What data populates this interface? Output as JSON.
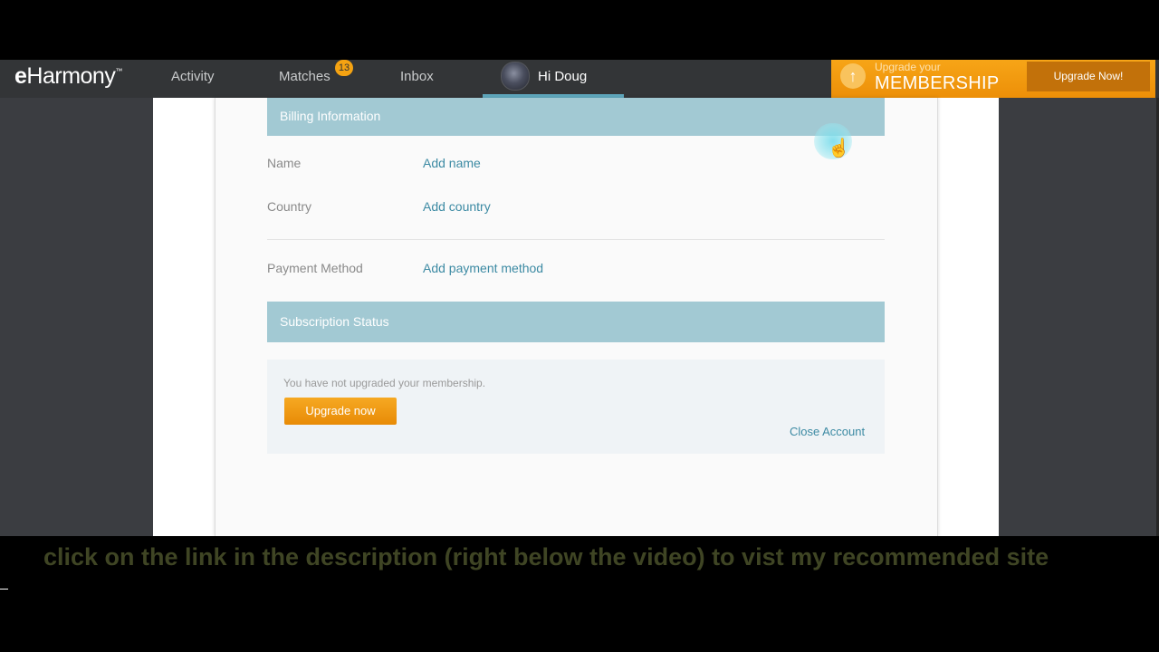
{
  "nav": {
    "logo": {
      "e": "e",
      "rest": "Harmony",
      "mark": "™"
    },
    "activity": "Activity",
    "matches": "Matches",
    "matches_badge": "13",
    "inbox": "Inbox",
    "user_greeting": "Hi Doug"
  },
  "upgrade_banner": {
    "small": "Upgrade your",
    "big": "MEMBERSHIP",
    "button": "Upgrade Now!",
    "icon": "↑"
  },
  "billing": {
    "header": "Billing Information",
    "name_label": "Name",
    "name_link": "Add name",
    "country_label": "Country",
    "country_link": "Add country",
    "payment_label": "Payment Method",
    "payment_link": "Add payment method"
  },
  "subscription": {
    "header": "Subscription Status",
    "status_text": "You have not upgraded your membership.",
    "upgrade_button": "Upgrade now",
    "close_account": "Close Account"
  },
  "caption": "click on the link in the description (right below the video) to vist my recommended site",
  "colors": {
    "accent_orange": "#f5a312",
    "section_header": "#a2c9d3",
    "link": "#3c8aa3",
    "nav_bg": "#333537"
  }
}
